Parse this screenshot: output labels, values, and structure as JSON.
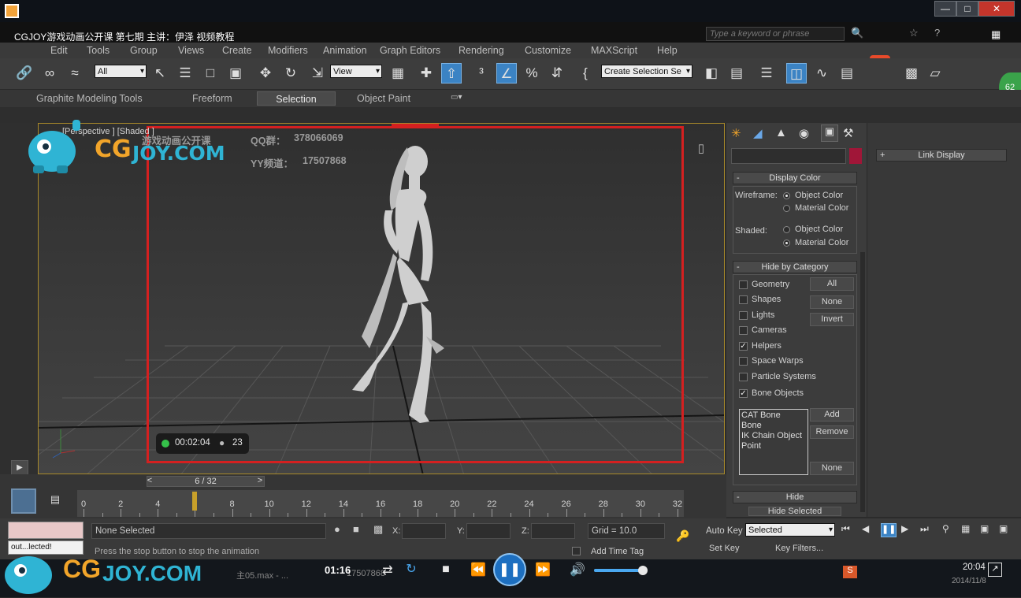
{
  "window": {
    "title": "CGJOY游戏动画公开课 第七期 主讲：伊泽 视频教程",
    "search_placeholder": "Type a keyword or phrase",
    "minimize": "—",
    "maximize": "□",
    "close": "✕"
  },
  "menu": [
    "Edit",
    "Tools",
    "Group",
    "Views",
    "Create",
    "Modifiers",
    "Animation",
    "Graph Editors",
    "Rendering",
    "Customize",
    "MAXScript",
    "Help"
  ],
  "toolbar": {
    "filter_value": "All",
    "refcoord_value": "View",
    "selection_set_value": "Create Selection Se"
  },
  "ribbon": {
    "tabs": [
      "Graphite Modeling Tools",
      "Freeform",
      "Selection",
      "Object Paint"
    ],
    "selected": "Selection"
  },
  "viewport": {
    "label": "[Perspective ] [Shaded ]",
    "watermark_title": "游戏动画公开课",
    "qq_label": "QQ群：",
    "qq_value": "378066069",
    "yy_label": "YY频道：",
    "yy_value": "17507868",
    "logo_text_cg": "CG",
    "logo_text_joy": "JOY.COM"
  },
  "recording": {
    "time": "00:02:04",
    "viewers": "23"
  },
  "command_panel": {
    "display_color": {
      "title": "Display Color",
      "wireframe_label": "Wireframe:",
      "shaded_label": "Shaded:",
      "options": [
        "Object Color",
        "Material Color"
      ],
      "wireframe_selected": "Object Color",
      "shaded_selected": "Material Color"
    },
    "hide_by_category": {
      "title": "Hide by Category",
      "categories": [
        {
          "label": "Geometry",
          "checked": false
        },
        {
          "label": "Shapes",
          "checked": false
        },
        {
          "label": "Lights",
          "checked": false
        },
        {
          "label": "Cameras",
          "checked": false
        },
        {
          "label": "Helpers",
          "checked": true
        },
        {
          "label": "Space Warps",
          "checked": false
        },
        {
          "label": "Particle Systems",
          "checked": false
        },
        {
          "label": "Bone Objects",
          "checked": true
        }
      ],
      "buttons": [
        "All",
        "None",
        "Invert"
      ],
      "list": [
        "CAT Bone",
        "Bone",
        "IK Chain Object",
        "Point"
      ],
      "list_buttons": [
        "Add",
        "Remove",
        "None"
      ]
    },
    "hide_title": "Hide",
    "hide_selected": "Hide Selected"
  },
  "right_panel": {
    "link_display": "Link Display"
  },
  "timeline": {
    "frame_display": "6 / 32",
    "prev": "<",
    "next": ">",
    "current_frame": 6,
    "ticks": [
      0,
      2,
      4,
      6,
      8,
      10,
      12,
      14,
      16,
      18,
      20,
      22,
      24,
      26,
      28,
      30,
      32
    ]
  },
  "status": {
    "selection": "None Selected",
    "prompt": "Press the stop button to stop the animation",
    "x_label": "X:",
    "y_label": "Y:",
    "z_label": "Z:",
    "grid": "Grid = 10.0",
    "add_time_tag": "Add Time Tag",
    "auto_key": "Auto Key",
    "auto_key_value": "Selected",
    "set_key": "Set Key",
    "key_filters": "Key Filters...",
    "mini_listener": "out...lected!"
  },
  "player": {
    "time": "01:16",
    "clock": "20:04",
    "date": "2014/11/8",
    "file": "主05.max - ...",
    "file2": "17507868"
  },
  "colors": {
    "accent": "#3b83c4",
    "safe_frame": "#d42020",
    "viewport_border": "#a98a2a"
  }
}
